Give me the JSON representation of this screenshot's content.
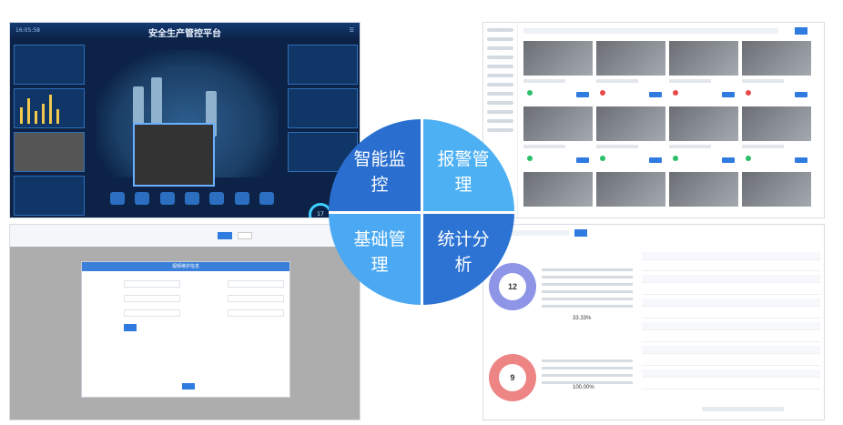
{
  "quadrants": {
    "top_left": "智能监控",
    "top_right": "报警管理",
    "bottom_left": "基础管理",
    "bottom_right": "统计分析"
  },
  "dashboard": {
    "title": "安全生产管控平台",
    "time": "16:05:58",
    "gauge_value": "17"
  },
  "form_modal": {
    "title": "视频维护信息"
  },
  "stats": {
    "donut_top_value": "12",
    "donut_bottom_value": "9",
    "top_legend_total": "33.33%",
    "bottom_legend_total": "100.00%"
  },
  "colors": {
    "tl": "#2a6fd0",
    "tr": "#4db0f3",
    "bl": "#4aa9f2",
    "br": "#2d73d4",
    "donut_top": "#8e94e6",
    "donut_bottom": "#ee8585"
  }
}
